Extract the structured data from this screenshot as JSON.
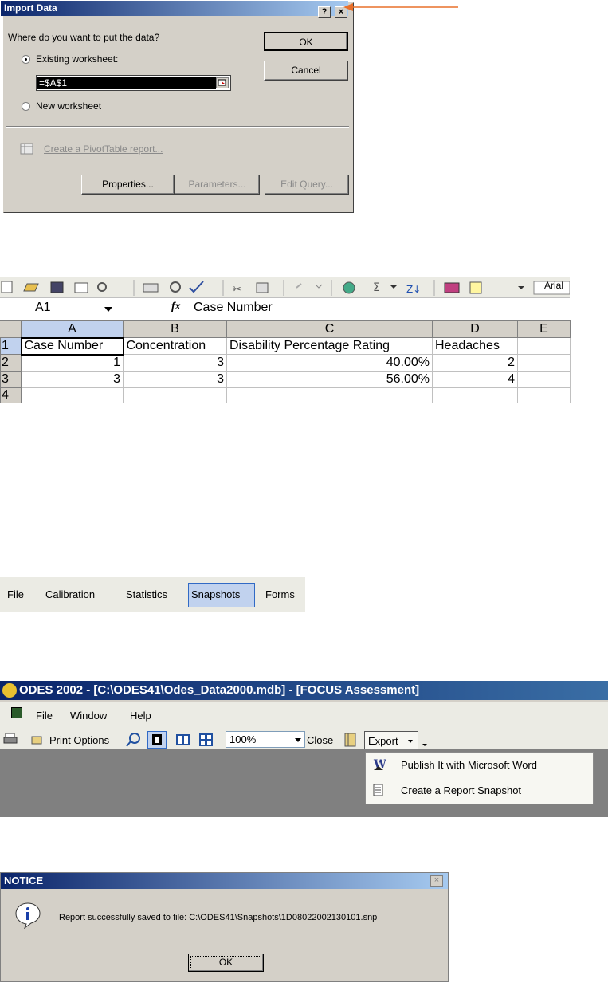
{
  "import_dialog": {
    "title": "Import Data",
    "help_btn": "?",
    "close_btn": "×",
    "question": "Where do you want to put the data?",
    "existing_worksheet": "Existing worksheet:",
    "cell_ref": "=$A$1",
    "new_worksheet": "New worksheet",
    "pivot_link": "Create a PivotTable report...",
    "ok": "OK",
    "cancel": "Cancel",
    "properties": "Properties...",
    "parameters": "Parameters...",
    "edit_query": "Edit Query..."
  },
  "excel": {
    "name_box": "A1",
    "fx": "fx",
    "formula": "Case Number",
    "font_box": "Arial",
    "columns": [
      "A",
      "B",
      "C",
      "D",
      "E"
    ],
    "rows": [
      {
        "num": "1",
        "cells": [
          "Case Number",
          "Concentration",
          "Disability Percentage Rating",
          "Headaches",
          ""
        ]
      },
      {
        "num": "2",
        "cells": [
          "1",
          "3",
          "40.00%",
          "2",
          ""
        ]
      },
      {
        "num": "3",
        "cells": [
          "3",
          "3",
          "56.00%",
          "4",
          ""
        ]
      },
      {
        "num": "4",
        "cells": [
          "",
          "",
          "",
          "",
          ""
        ]
      }
    ]
  },
  "menubar": {
    "items": [
      "File",
      "Calibration",
      "Statistics",
      "Snapshots",
      "Forms"
    ],
    "active": "Snapshots"
  },
  "odes": {
    "title": "ODES 2002 - [C:\\ODES41\\Odes_Data2000.mdb] - [FOCUS Assessment]",
    "menu": [
      "File",
      "Window",
      "Help"
    ],
    "print_options": "Print Options",
    "zoom": "100%",
    "close": "Close",
    "export": "Export",
    "export_menu": [
      "Publish It with Microsoft Word",
      "Create a Report Snapshot"
    ]
  },
  "notice": {
    "title": "NOTICE",
    "message": "Report successfully saved to file: C:\\ODES41\\Snapshots\\1D08022002130101.snp",
    "ok": "OK"
  },
  "colors": {
    "dialog_bg": "#d4d0c8",
    "title_blue": "#0a246a",
    "arrow_orange": "#e8702a",
    "selection_blue": "#c1d2ee"
  }
}
